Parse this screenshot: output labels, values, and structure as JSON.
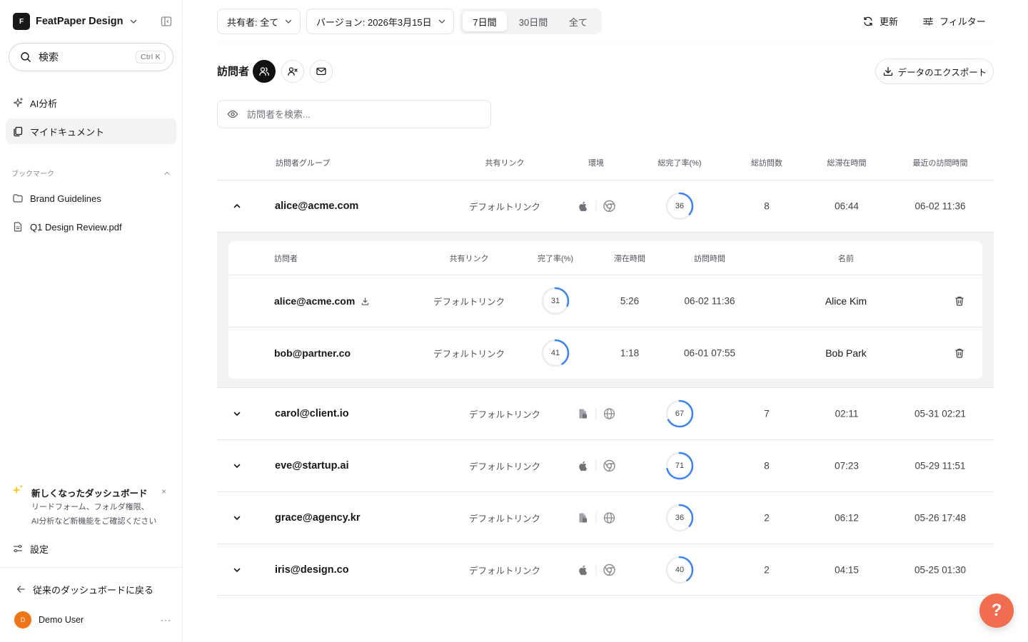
{
  "workspace": {
    "logo_letter": "F",
    "name": "FeatPaper Design"
  },
  "sidebar": {
    "search_label": "検索",
    "search_shortcut": "Ctrl K",
    "nav": [
      {
        "label": "AI分析",
        "icon": "sparkles-icon"
      },
      {
        "label": "マイドキュメント",
        "icon": "documents-icon",
        "active": true
      }
    ],
    "bookmarks_heading": "ブックマーク",
    "bookmarks": [
      {
        "label": "Brand Guidelines",
        "icon": "folder-icon"
      },
      {
        "label": "Q1 Design Review.pdf",
        "icon": "file-icon"
      }
    ],
    "promo": {
      "title": "新しくなったダッシュボード",
      "line1": "リードフォーム、フォルダ権限、",
      "line2": "AI分析など新機能をご確認ください",
      "close": "×"
    },
    "settings_label": "設定",
    "back_label": "従来のダッシュボードに戻る",
    "user": {
      "initial": "D",
      "name": "Demo User",
      "more": "···"
    }
  },
  "topbar": {
    "sharer_filter": "共有者: 全て",
    "version_filter": "バージョン: 2026年3月15日",
    "periods": [
      "7日間",
      "30日間",
      "全て"
    ],
    "active_period": "7日間",
    "refresh_label": "更新",
    "filter_label": "フィルター"
  },
  "section": {
    "title": "訪問者",
    "export_label": "データのエクスポート",
    "search_placeholder": "訪問者を検索..."
  },
  "table": {
    "headers": {
      "group": "訪問者グループ",
      "link": "共有リンク",
      "env": "環境",
      "completion": "総完了率(%)",
      "visits": "総訪問数",
      "duration": "総滞在時間",
      "last_visit": "最近の訪問時間"
    },
    "rows": [
      {
        "email": "alice@acme.com",
        "link": "デフォルトリンク",
        "os": "apple-icon",
        "browser": "chrome-icon",
        "completion": 36,
        "visits": "8",
        "duration": "06:44",
        "last": "06-02 11:36",
        "expanded": true
      },
      {
        "email": "carol@client.io",
        "link": "デフォルトリンク",
        "os": "android-icon",
        "browser": "globe-icon",
        "completion": 67,
        "visits": "7",
        "duration": "02:11",
        "last": "05-31 02:21"
      },
      {
        "email": "eve@startup.ai",
        "link": "デフォルトリンク",
        "os": "apple-icon",
        "browser": "chrome-icon",
        "completion": 71,
        "visits": "8",
        "duration": "07:23",
        "last": "05-29 11:51"
      },
      {
        "email": "grace@agency.kr",
        "link": "デフォルトリンク",
        "os": "android-icon",
        "browser": "globe-icon",
        "completion": 36,
        "visits": "2",
        "duration": "06:12",
        "last": "05-26 17:48"
      },
      {
        "email": "iris@design.co",
        "link": "デフォルトリンク",
        "os": "apple-icon",
        "browser": "chrome-icon",
        "completion": 40,
        "visits": "2",
        "duration": "04:15",
        "last": "05-25 01:30"
      }
    ]
  },
  "subtable": {
    "headers": {
      "visitor": "訪問者",
      "link": "共有リンク",
      "completion": "完了率(%)",
      "duration": "滞在時間",
      "time": "訪問時間",
      "name": "名前"
    },
    "rows": [
      {
        "email": "alice@acme.com",
        "downloaded": true,
        "link": "デフォルトリンク",
        "completion": 31,
        "duration": "5:26",
        "time": "06-02 11:36",
        "name": "Alice Kim"
      },
      {
        "email": "bob@partner.co",
        "downloaded": false,
        "link": "デフォルトリンク",
        "completion": 41,
        "duration": "1:18",
        "time": "06-01 07:55",
        "name": "Bob Park"
      }
    ]
  },
  "help_label": "?",
  "colors": {
    "accent": "#3b82f6",
    "ring_track": "#ececee",
    "help": "#f26d4f",
    "avatar": "#f07316"
  }
}
